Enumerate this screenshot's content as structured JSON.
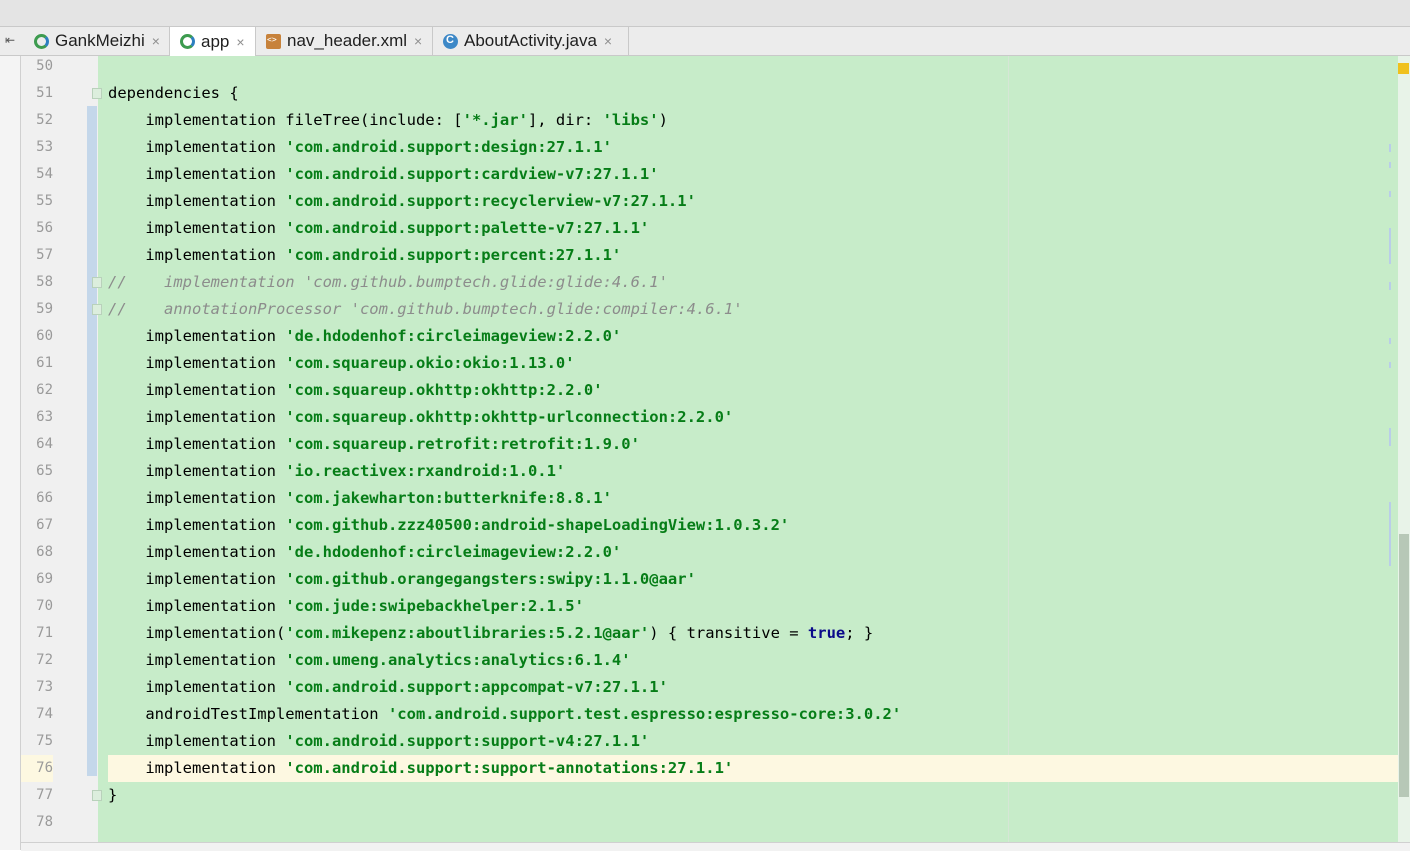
{
  "toolbar": {
    "back_glyph": "⇤"
  },
  "tabs": [
    {
      "label": "GankMeizhi",
      "icon": "gradle-icon",
      "active": false
    },
    {
      "label": "app",
      "icon": "gradle-icon",
      "active": true
    },
    {
      "label": "nav_header.xml",
      "icon": "xml-file-icon",
      "active": false
    },
    {
      "label": "AboutActivity.java",
      "icon": "java-class-icon",
      "active": false
    }
  ],
  "tab_close_glyph": "×",
  "editor": {
    "first_line": 50,
    "caret_line": 76,
    "lines": [
      {
        "n": "50",
        "parts": []
      },
      {
        "n": "51",
        "parts": [
          [
            "p",
            "dependencies {"
          ]
        ]
      },
      {
        "n": "52",
        "parts": [
          [
            "p",
            "    implementation fileTree(include: ["
          ],
          [
            "s",
            "'*.jar'"
          ],
          [
            "p",
            "], dir: "
          ],
          [
            "s",
            "'libs'"
          ],
          [
            "p",
            ")"
          ]
        ]
      },
      {
        "n": "53",
        "parts": [
          [
            "p",
            "    implementation "
          ],
          [
            "s",
            "'com.android.support:design:27.1.1'"
          ]
        ]
      },
      {
        "n": "54",
        "parts": [
          [
            "p",
            "    implementation "
          ],
          [
            "s",
            "'com.android.support:cardview-v7:27.1.1'"
          ]
        ]
      },
      {
        "n": "55",
        "parts": [
          [
            "p",
            "    implementation "
          ],
          [
            "s",
            "'com.android.support:recyclerview-v7:27.1.1'"
          ]
        ]
      },
      {
        "n": "56",
        "parts": [
          [
            "p",
            "    implementation "
          ],
          [
            "s",
            "'com.android.support:palette-v7:27.1.1'"
          ]
        ]
      },
      {
        "n": "57",
        "parts": [
          [
            "p",
            "    implementation "
          ],
          [
            "s",
            "'com.android.support:percent:27.1.1'"
          ]
        ]
      },
      {
        "n": "58",
        "parts": [
          [
            "c",
            "//    implementation 'com.github.bumptech.glide:glide:4.6.1'"
          ]
        ]
      },
      {
        "n": "59",
        "parts": [
          [
            "c",
            "//    annotationProcessor 'com.github.bumptech.glide:compiler:4.6.1'"
          ]
        ]
      },
      {
        "n": "60",
        "parts": [
          [
            "p",
            "    implementation "
          ],
          [
            "s",
            "'de.hdodenhof:circleimageview:2.2.0'"
          ]
        ]
      },
      {
        "n": "61",
        "parts": [
          [
            "p",
            "    implementation "
          ],
          [
            "s",
            "'com.squareup.okio:okio:1.13.0'"
          ]
        ]
      },
      {
        "n": "62",
        "parts": [
          [
            "p",
            "    implementation "
          ],
          [
            "s",
            "'com.squareup.okhttp:okhttp:2.2.0'"
          ]
        ]
      },
      {
        "n": "63",
        "parts": [
          [
            "p",
            "    implementation "
          ],
          [
            "s",
            "'com.squareup.okhttp:okhttp-urlconnection:2.2.0'"
          ]
        ]
      },
      {
        "n": "64",
        "parts": [
          [
            "p",
            "    implementation "
          ],
          [
            "s",
            "'com.squareup.retrofit:retrofit:1.9.0'"
          ]
        ]
      },
      {
        "n": "65",
        "parts": [
          [
            "p",
            "    implementation "
          ],
          [
            "s",
            "'io.reactivex:rxandroid:1.0.1'"
          ]
        ]
      },
      {
        "n": "66",
        "parts": [
          [
            "p",
            "    implementation "
          ],
          [
            "s",
            "'com.jakewharton:butterknife:8.8.1'"
          ]
        ]
      },
      {
        "n": "67",
        "parts": [
          [
            "p",
            "    implementation "
          ],
          [
            "s",
            "'com.github.zzz40500:android-shapeLoadingView:1.0.3.2'"
          ]
        ]
      },
      {
        "n": "68",
        "parts": [
          [
            "p",
            "    implementation "
          ],
          [
            "s",
            "'de.hdodenhof:circleimageview:2.2.0'"
          ]
        ]
      },
      {
        "n": "69",
        "parts": [
          [
            "p",
            "    implementation "
          ],
          [
            "s",
            "'com.github.orangegangsters:swipy:1.1.0@aar'"
          ]
        ]
      },
      {
        "n": "70",
        "parts": [
          [
            "p",
            "    implementation "
          ],
          [
            "s",
            "'com.jude:swipebackhelper:2.1.5'"
          ]
        ]
      },
      {
        "n": "71",
        "parts": [
          [
            "p",
            "    implementation("
          ],
          [
            "s",
            "'com.mikepenz:aboutlibraries:5.2.1@aar'"
          ],
          [
            "p",
            ") { transitive = "
          ],
          [
            "k",
            "true"
          ],
          [
            "p",
            "; }"
          ]
        ]
      },
      {
        "n": "72",
        "parts": [
          [
            "p",
            "    implementation "
          ],
          [
            "s",
            "'com.umeng.analytics:analytics:6.1.4'"
          ]
        ]
      },
      {
        "n": "73",
        "parts": [
          [
            "p",
            "    implementation "
          ],
          [
            "s",
            "'com.android.support:appcompat-v7:27.1.1'"
          ]
        ]
      },
      {
        "n": "74",
        "parts": [
          [
            "p",
            "    androidTestImplementation "
          ],
          [
            "s",
            "'com.android.support.test.espresso:espresso-core:3.0.2'"
          ]
        ]
      },
      {
        "n": "75",
        "parts": [
          [
            "p",
            "    implementation "
          ],
          [
            "s",
            "'com.android.support:support-v4:27.1.1'"
          ]
        ]
      },
      {
        "n": "76",
        "parts": [
          [
            "p",
            "    implementation "
          ],
          [
            "s",
            "'com.android.support:support-annotations:27.1.1'"
          ]
        ]
      },
      {
        "n": "77",
        "parts": [
          [
            "p",
            "}"
          ]
        ]
      },
      {
        "n": "78",
        "parts": []
      }
    ]
  },
  "colors": {
    "code_background": "#c7ecc9",
    "string": "#067d17",
    "keyword": "#0a0a8a",
    "comment": "#8c8c8c",
    "caret_row": "#fdf8e1",
    "change_marker": "#c4d7ea",
    "warning_marker": "#f0c11d"
  }
}
